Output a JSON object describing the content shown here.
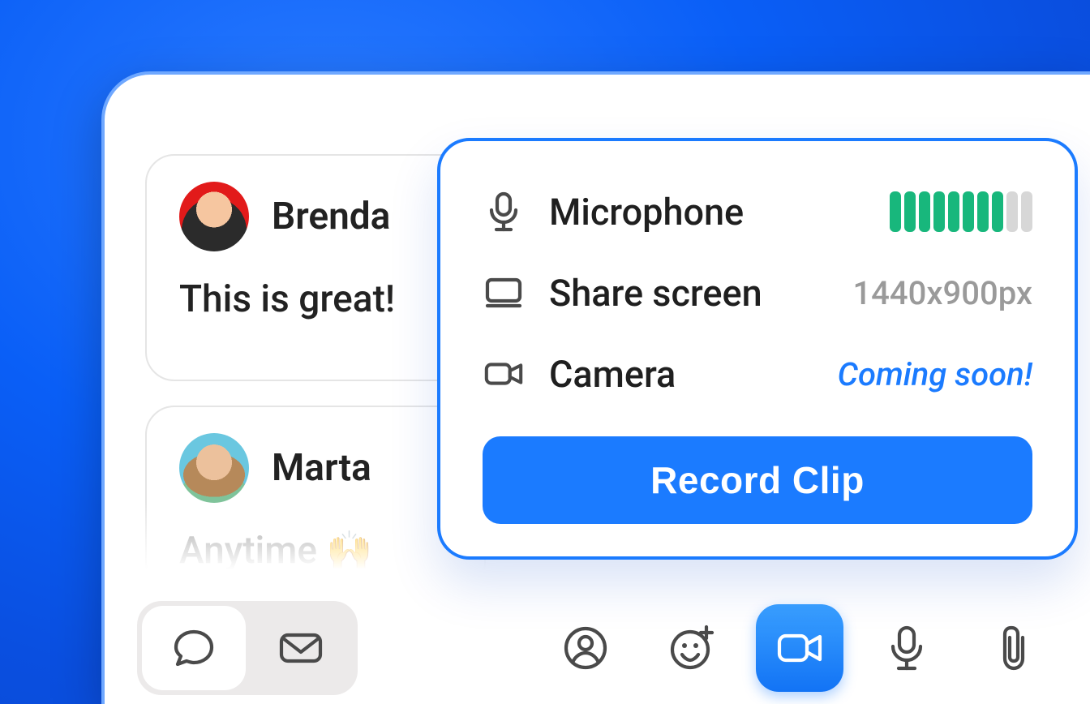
{
  "chats": [
    {
      "name": "Brenda",
      "message": "This is great!"
    },
    {
      "name": "Marta",
      "message": "Anytime 🙌"
    }
  ],
  "popover": {
    "mic": {
      "label": "Microphone",
      "level_on": 8,
      "level_total": 10
    },
    "screen": {
      "label": "Share screen",
      "value": "1440x900px"
    },
    "camera": {
      "label": "Camera",
      "value": "Coming soon!"
    },
    "record_label": "Record Clip"
  },
  "icons": {
    "microphone": "microphone-icon",
    "screen": "screen-icon",
    "camera": "camera-icon",
    "chat": "chat-bubble-icon",
    "mail": "mail-icon",
    "person": "person-circle-icon",
    "emoji_add": "emoji-add-icon",
    "video": "video-icon",
    "mic_tool": "microphone-icon",
    "attach": "paperclip-icon"
  }
}
